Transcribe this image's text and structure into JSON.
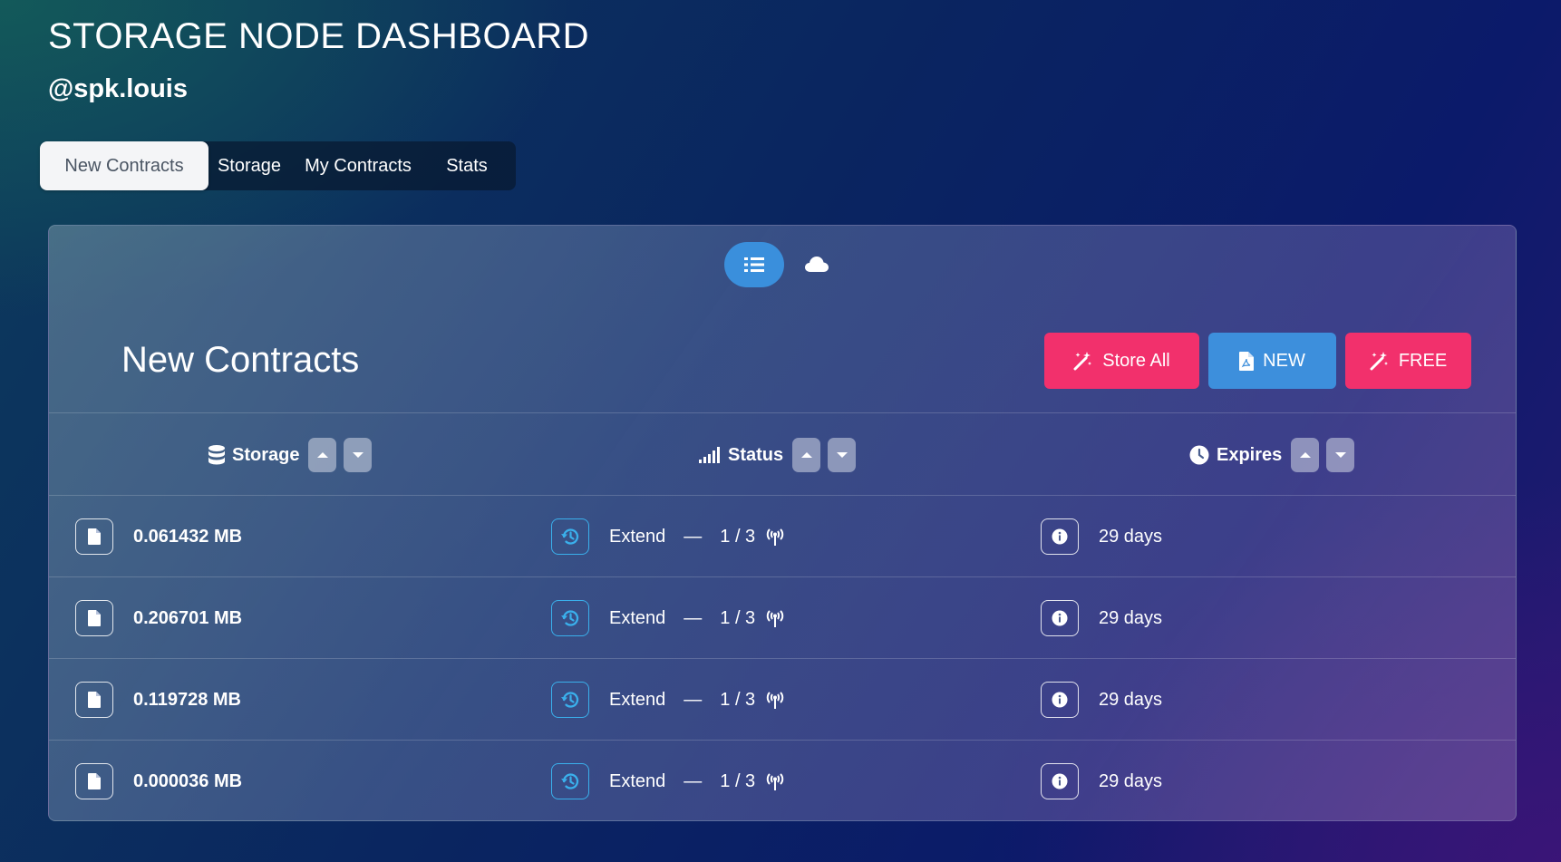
{
  "app": {
    "title": "STORAGE NODE DASHBOARD",
    "user": "@spk.louis"
  },
  "tabs": [
    {
      "label": "New Contracts",
      "active": true
    },
    {
      "label": "Storage",
      "active": false
    },
    {
      "label": "My Contracts",
      "active": false
    },
    {
      "label": "Stats",
      "active": false
    }
  ],
  "view_toggle": {
    "list_icon": "list-icon",
    "cloud_icon": "cloud-icon",
    "active": "list"
  },
  "panel": {
    "title": "New Contracts",
    "actions": {
      "store_all": "Store All",
      "new": "NEW",
      "free": "FREE"
    }
  },
  "table": {
    "headers": {
      "storage": "Storage",
      "status": "Status",
      "expires": "Expires"
    },
    "rows": [
      {
        "size": "0.061432 MB",
        "action": "Extend",
        "sep": "—",
        "peers": "1 / 3",
        "expires": "29 days"
      },
      {
        "size": "0.206701 MB",
        "action": "Extend",
        "sep": "—",
        "peers": "1 / 3",
        "expires": "29 days"
      },
      {
        "size": "0.119728 MB",
        "action": "Extend",
        "sep": "—",
        "peers": "1 / 3",
        "expires": "29 days"
      },
      {
        "size": "0.000036 MB",
        "action": "Extend",
        "sep": "—",
        "peers": "1 / 3",
        "expires": "29 days"
      }
    ]
  },
  "colors": {
    "pink": "#f2306c",
    "blue": "#3d8fdc",
    "extend_accent": "#3ab0ec"
  }
}
